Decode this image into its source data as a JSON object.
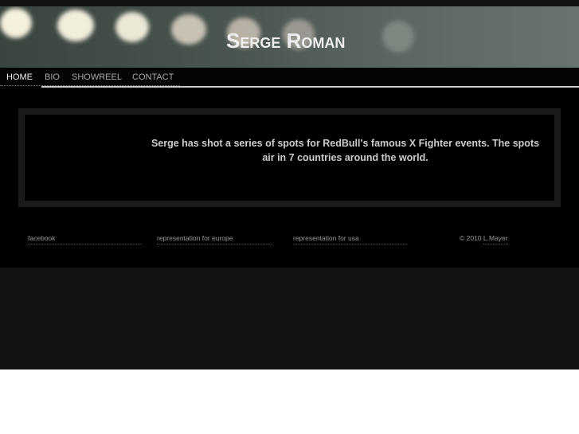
{
  "header": {
    "title": "Serge Roman"
  },
  "nav": {
    "items": [
      {
        "label": "HOME"
      },
      {
        "label": "BIO"
      },
      {
        "label": "SHOWREEL"
      },
      {
        "label": "CONTACT"
      }
    ]
  },
  "main": {
    "story": "Serge has shot a series of spots for RedBull's famous X Fighter events. The spots air in 7 countries around the world."
  },
  "footer": {
    "links": [
      {
        "label": "facebook"
      },
      {
        "label": "representation for europe"
      },
      {
        "label": "representation for usa"
      }
    ],
    "copyright_prefix": "© 2010 ",
    "copyright_name": "L.Mayer"
  }
}
